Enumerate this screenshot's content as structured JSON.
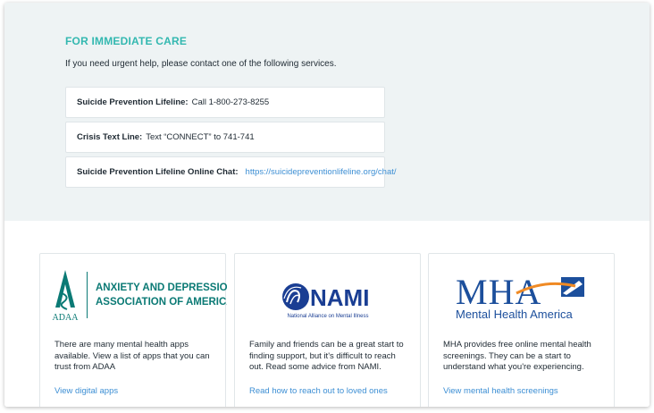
{
  "immediate_care": {
    "title": "FOR IMMEDIATE CARE",
    "intro": "If you need urgent help, please contact one of the following services.",
    "services": [
      {
        "label": "Suicide Prevention Lifeline:",
        "value": "Call 1-800-273-8255"
      },
      {
        "label": "Crisis Text Line:",
        "value": "Text “CONNECT” to 741-741"
      },
      {
        "label": "Suicide Prevention Lifeline Online Chat:",
        "value": "https://suicidepreventionlifeline.org/chat/"
      }
    ]
  },
  "cards": [
    {
      "logo": {
        "monogram": "ADAA",
        "line1": "ANXIETY AND DEPRESSION",
        "line2": "ASSOCIATION OF AMERICA",
        "color": "#0b7a75"
      },
      "text": "There are many mental health apps available. View a list of apps that you can trust from ADAA",
      "link": "View digital apps"
    },
    {
      "logo": {
        "wordmark": "NAMI",
        "tagline": "National Alliance on Mental Illness",
        "color": "#1a3e93"
      },
      "text": "Family and friends can be a great start to finding support, but it's difficult to reach out. Read some advice from NAMI.",
      "link": "Read how to reach out to loved ones"
    },
    {
      "logo": {
        "wordmark": "MHA",
        "tagline": "Mental Health America",
        "color": "#1c4f9c",
        "accent": "#f08a24"
      },
      "text": "MHA provides free online mental health screenings. They can be a start to understand what you're experiencing.",
      "link": "View mental health screenings"
    }
  ],
  "colors": {
    "accent": "#33b8b0",
    "link": "#3d8fd4",
    "panel_bg": "#eef3f4"
  }
}
